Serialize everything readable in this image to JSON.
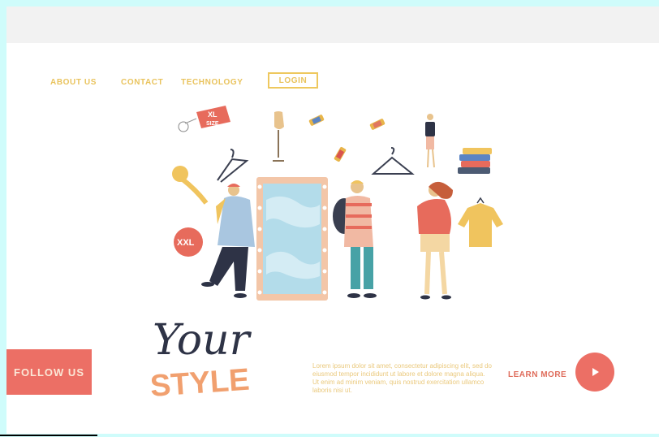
{
  "nav": {
    "about": "ABOUT US",
    "contact": "CONTACT",
    "technology": "TECHNOLOGY",
    "login": "LOGIN"
  },
  "illustration": {
    "tag_xl_line1": "XL",
    "tag_xl_line2": "SIZE",
    "tag_xxl": "XXL"
  },
  "hero": {
    "headline_line1": "Your",
    "headline_line2": "STYLE",
    "body": "Lorem ipsum dolor sit amet, consectetur adipiscing elit, sed do eiusmod tempor incididunt ut labore et dolore magna aliqua. Ut enim ad minim veniam, quis nostrud exercitation ullamco laboris nisi ut.",
    "learn_more": "LEARN MORE",
    "follow_us": "FOLLOW US"
  },
  "colors": {
    "nav_gold": "#e9c35d",
    "accent_coral": "#ec6f65",
    "background_cyan": "#cffcfb",
    "headline_dark": "#2e3346",
    "headline_orange": "#f1a06f"
  },
  "icons": {
    "play": "play-icon",
    "hanger": "hanger-icon",
    "mirror": "mirror-icon"
  }
}
